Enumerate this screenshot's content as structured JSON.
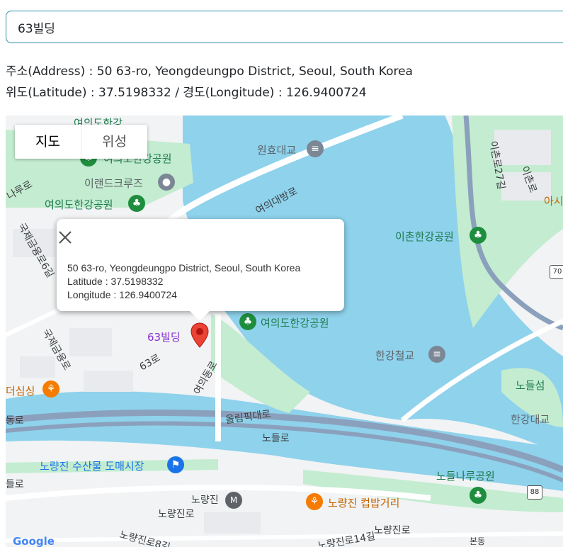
{
  "search": {
    "value": "63빌딩"
  },
  "info": {
    "address_line": "주소(Address) : 50 63-ro, Yeongdeungpo District, Seoul, South Korea",
    "coord_line": "위도(Latitude) : 37.5198332 / 경도(Longitude) : 126.9400724"
  },
  "map_type": {
    "map": "지도",
    "satellite": "위성"
  },
  "popup": {
    "address": "50 63-ro, Yeongdeungpo District, Seoul, South Korea",
    "latitude": "Latitude : 37.5198332",
    "longitude": "Longitude : 126.9400724"
  },
  "marker_label": "63빌딩",
  "map_labels": {
    "yeouido_park_top": "여의도한강",
    "yeouido_park_2": "여의도한강공원",
    "yeouido_park_3": "여의도한강공원",
    "yeouido_park_4": "여의도한강공원",
    "eland_cruise": "이랜드크루즈",
    "wonhyo_bridge": "원효대교",
    "yeouidaebang_ro": "여의대방로",
    "ichon_park": "이촌한강공원",
    "ichon_ro_27": "이촌로27길",
    "ichon_ro": "이촌로",
    "ashi": "아시",
    "hangang_rail": "한강철교",
    "nodeulseom": "노들섬",
    "hangang_bridge": "한강대교",
    "olympic_ro": "올림픽대로",
    "nodeul_ro": "노들로",
    "yeouidong_ro": "여의동로",
    "road_63": "63로",
    "gukje_geumyung_ro": "국제금융로",
    "gukje_geumyung_ro_6": "국제금융로6길",
    "naru_ro": "나루로",
    "dong_ro": "동로",
    "sisik": "더심싱",
    "fish_market": "노량진 수산물 도매시장",
    "deul_ro": "들로",
    "noryangjin": "노량진",
    "cupbap": "노량진 컵밥거리",
    "noryangjin_ro": "노량진로",
    "nodeul_naru_park": "노들나루공원",
    "noryangjin_ro_14": "노량진로14길",
    "noryangjin_ro_8": "노량진로8길",
    "bondong": "본동",
    "route_70": "70",
    "route_88": "88",
    "google": "Google"
  },
  "colors": {
    "water": "#8ed2ec",
    "park": "#c3ecd0",
    "land": "#f1f3f4",
    "highway": "#8ba0bc",
    "marker": "#ea4335",
    "accent": "#2d8ba8"
  },
  "icons": {
    "close": "close-icon",
    "marker": "map-marker-icon",
    "park": "tree-icon",
    "bridge": "bridge-icon",
    "restaurant": "fork-knife-icon",
    "shopping": "cart-icon",
    "subway": "metro-icon"
  }
}
